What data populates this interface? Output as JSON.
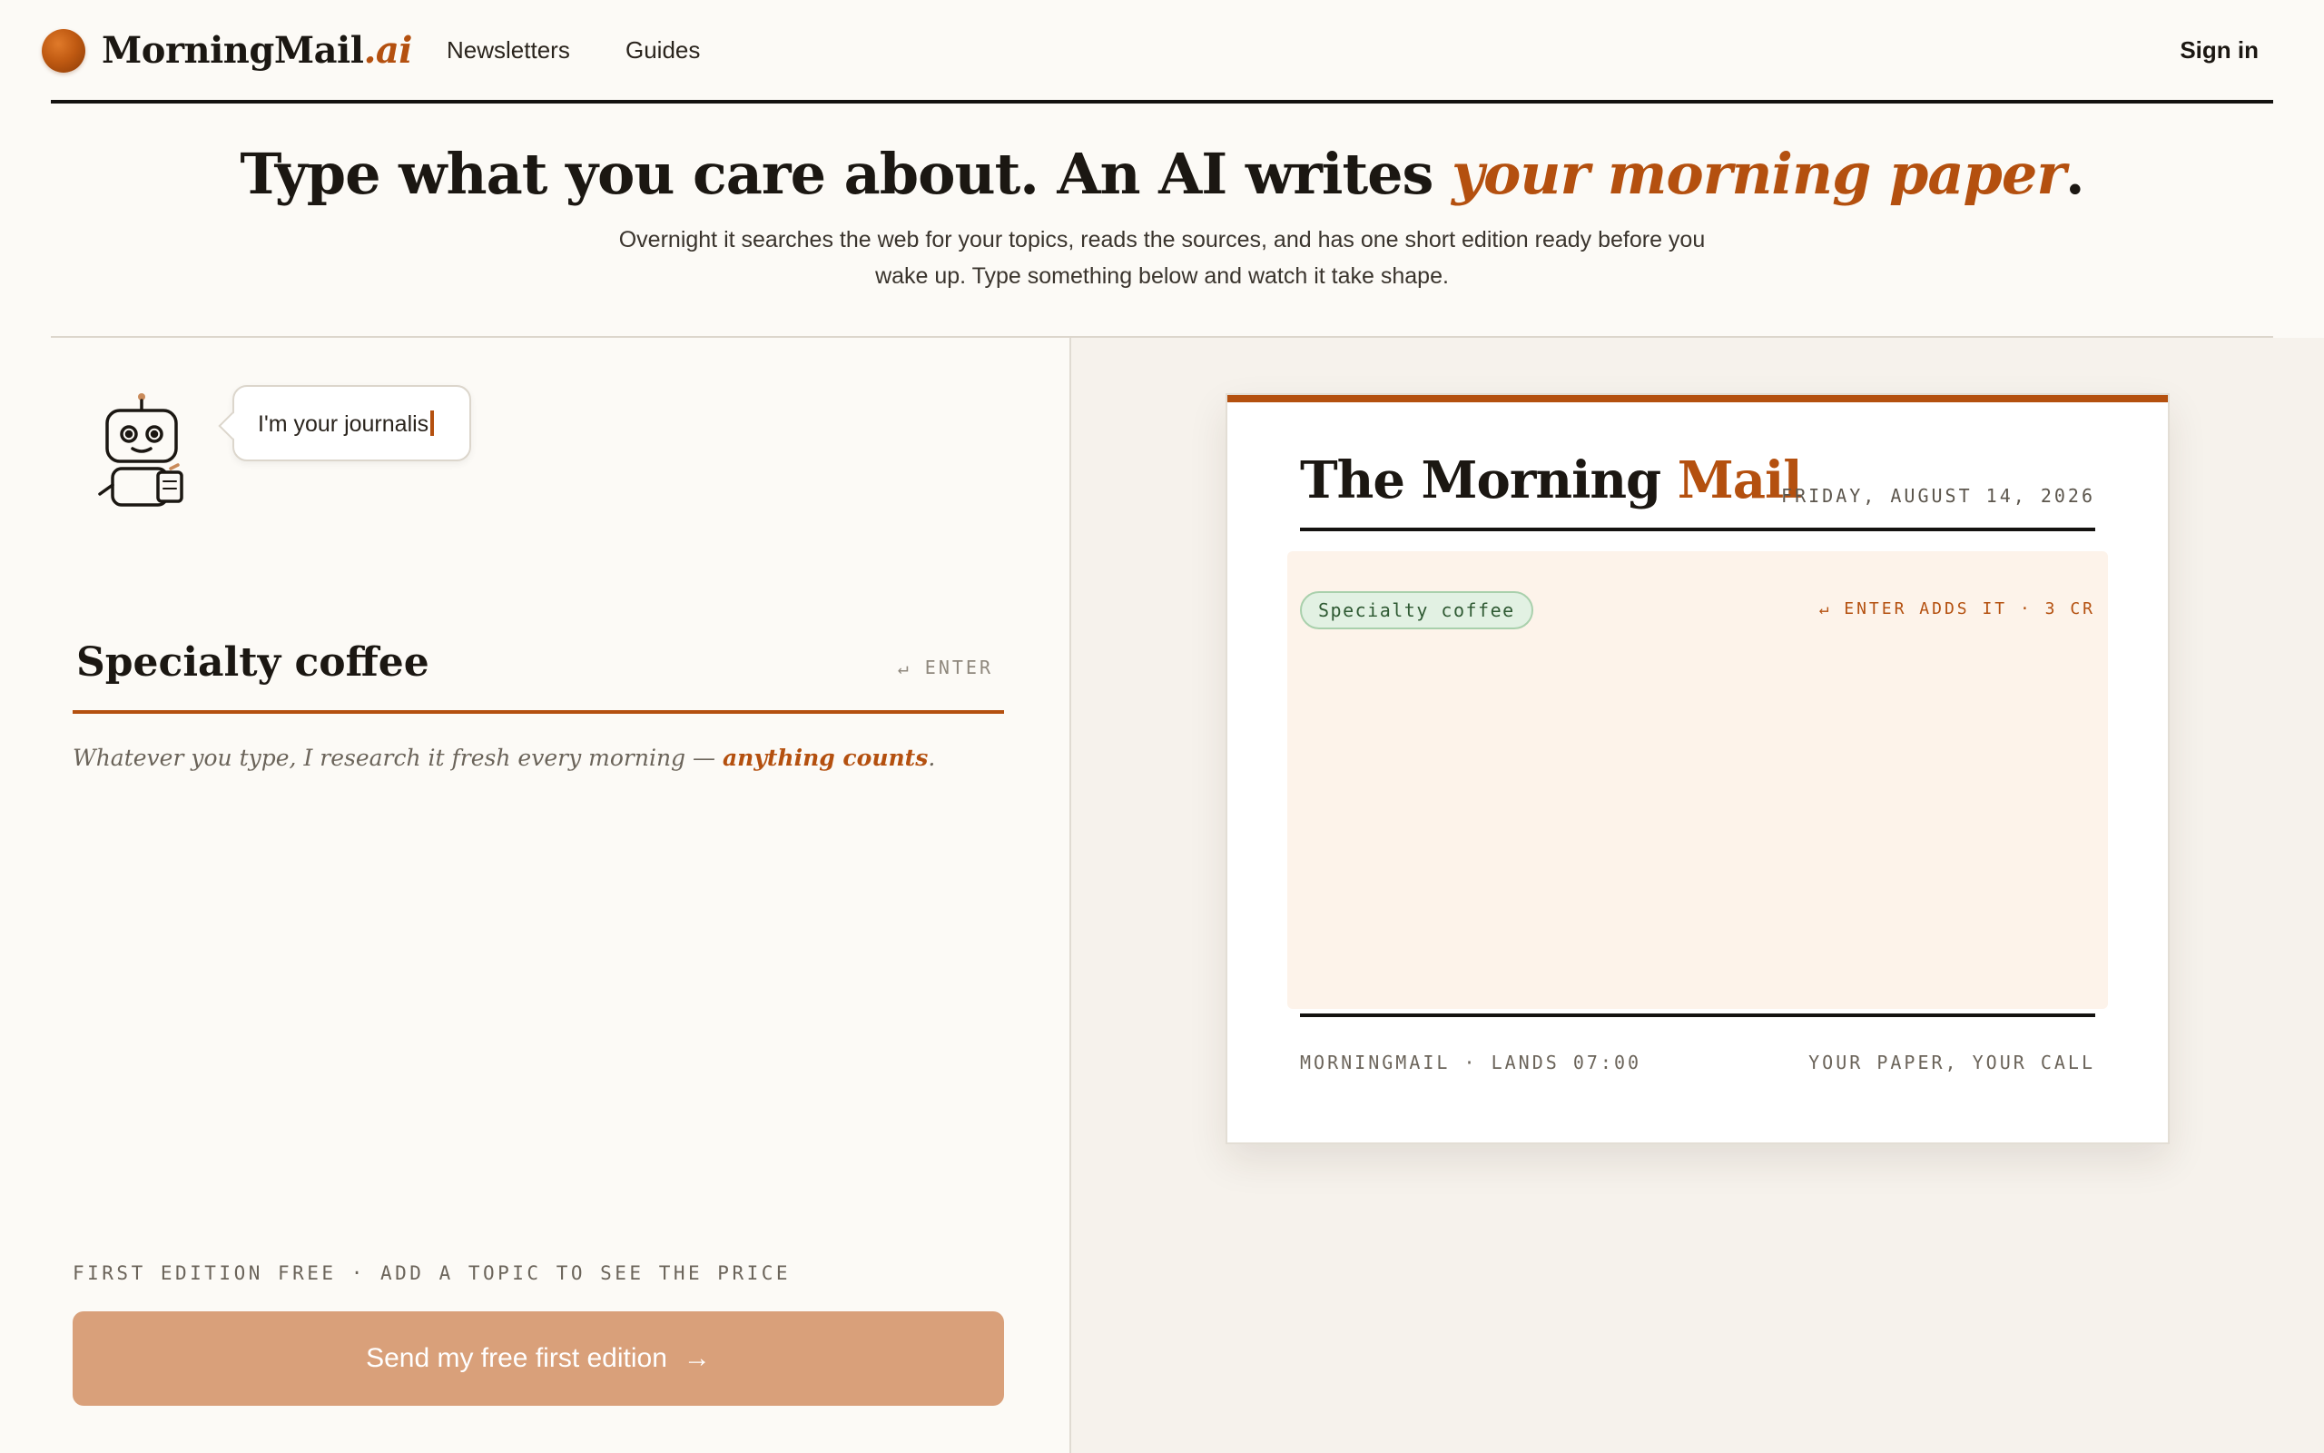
{
  "header": {
    "brand_name": "MorningMail",
    "brand_suffix": ".ai",
    "nav": [
      "Newsletters",
      "Guides"
    ],
    "sign_in": "Sign in"
  },
  "hero": {
    "title_main": "Type what you care about. An AI writes ",
    "title_accent": "your morning paper",
    "title_end": ".",
    "subtitle": "Overnight it searches the web for your topics, reads the sources, and has one short edition ready before you wake up. Type something below and watch it take shape."
  },
  "left": {
    "bubble_text": "I'm your journalis",
    "topic_value": "Specialty coffee",
    "enter_hint": "↵ ENTER",
    "helper_text": "Whatever you type, I research it fresh every morning — ",
    "helper_link": "anything counts",
    "helper_end": ".",
    "price_note": "FIRST EDITION FREE · ADD A TOPIC TO SEE THE PRICE",
    "cta_label": "Send my free first edition",
    "cta_arrow": "→"
  },
  "paper": {
    "title_main": "The Morning ",
    "title_accent": "Mail",
    "date": "FRIDAY, AUGUST 14, 2026",
    "topic_chip": "Specialty coffee",
    "enter_adds": "↵ ENTER ADDS IT · 3 CR",
    "footer_left": "MORNINGMAIL · LANDS 07:00",
    "footer_right": "YOUR PAPER, YOUR CALL"
  },
  "colors": {
    "accent": "#b4500f",
    "cta": "#d9a07a",
    "chip_bg": "#e2f1e3",
    "paper_body": "#fdf3ea"
  },
  "icons": {
    "logo": "orange-sphere-icon",
    "mascot": "robot-reporter-icon",
    "enter": "return-arrow-icon",
    "cta": "arrow-right-icon"
  }
}
